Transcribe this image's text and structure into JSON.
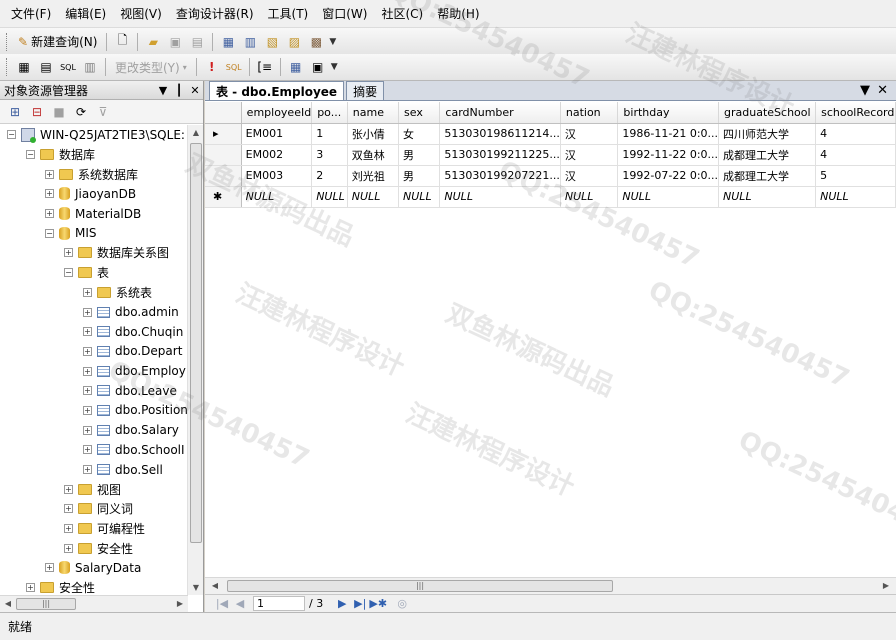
{
  "menubar": [
    "文件(F)",
    "编辑(E)",
    "视图(V)",
    "查询设计器(R)",
    "工具(T)",
    "窗口(W)",
    "社区(C)",
    "帮助(H)"
  ],
  "toolbar1": {
    "new_query": "新建查询(N)"
  },
  "toolbar2": {
    "change_type": "更改类型(Y)"
  },
  "object_explorer": {
    "title": "对象资源管理器",
    "tree": [
      {
        "depth": 0,
        "icon": "server-icon",
        "expander": "−",
        "label": "WIN-Q25JAT2TIE3\\SQLE:"
      },
      {
        "depth": 1,
        "icon": "folder-icon",
        "expander": "−",
        "label": "数据库"
      },
      {
        "depth": 2,
        "icon": "folder-icon",
        "expander": "+",
        "label": "系统数据库"
      },
      {
        "depth": 2,
        "icon": "database-icon",
        "expander": "+",
        "label": "JiaoyanDB"
      },
      {
        "depth": 2,
        "icon": "database-icon",
        "expander": "+",
        "label": "MaterialDB"
      },
      {
        "depth": 2,
        "icon": "database-icon",
        "expander": "−",
        "label": "MIS"
      },
      {
        "depth": 3,
        "icon": "folder-icon",
        "expander": "+",
        "label": "数据库关系图"
      },
      {
        "depth": 3,
        "icon": "folder-icon",
        "expander": "−",
        "label": "表"
      },
      {
        "depth": 4,
        "icon": "folder-icon",
        "expander": "+",
        "label": "系统表"
      },
      {
        "depth": 4,
        "icon": "table-icon",
        "expander": "+",
        "label": "dbo.admin"
      },
      {
        "depth": 4,
        "icon": "table-icon",
        "expander": "+",
        "label": "dbo.Chuqin"
      },
      {
        "depth": 4,
        "icon": "table-icon",
        "expander": "+",
        "label": "dbo.Depart"
      },
      {
        "depth": 4,
        "icon": "table-icon",
        "expander": "+",
        "label": "dbo.Employ"
      },
      {
        "depth": 4,
        "icon": "table-icon",
        "expander": "+",
        "label": "dbo.Leave"
      },
      {
        "depth": 4,
        "icon": "table-icon",
        "expander": "+",
        "label": "dbo.Position"
      },
      {
        "depth": 4,
        "icon": "table-icon",
        "expander": "+",
        "label": "dbo.Salary"
      },
      {
        "depth": 4,
        "icon": "table-icon",
        "expander": "+",
        "label": "dbo.SchoolI"
      },
      {
        "depth": 4,
        "icon": "table-icon",
        "expander": "+",
        "label": "dbo.Sell"
      },
      {
        "depth": 3,
        "icon": "folder-icon",
        "expander": "+",
        "label": "视图"
      },
      {
        "depth": 3,
        "icon": "folder-icon",
        "expander": "+",
        "label": "同义词"
      },
      {
        "depth": 3,
        "icon": "folder-icon",
        "expander": "+",
        "label": "可编程性"
      },
      {
        "depth": 3,
        "icon": "folder-icon",
        "expander": "+",
        "label": "安全性"
      },
      {
        "depth": 2,
        "icon": "database-icon",
        "expander": "+",
        "label": "SalaryData"
      },
      {
        "depth": 1,
        "icon": "folder-icon",
        "expander": "+",
        "label": "安全性"
      }
    ]
  },
  "tabs": [
    {
      "label": "表 - dbo.Employee",
      "active": true
    },
    {
      "label": "摘要",
      "active": false
    }
  ],
  "grid": {
    "columns": [
      "employeeId",
      "po...",
      "name",
      "sex",
      "cardNumber",
      "nation",
      "birthday",
      "graduateSchool",
      "schoolRecord"
    ],
    "rows": [
      {
        "marker": "▸",
        "cells": [
          "EM001",
          "1",
          "张小倩",
          "女",
          "513030198611214...",
          "汉",
          "1986-11-21 0:0...",
          "四川师范大学",
          "4"
        ]
      },
      {
        "marker": "",
        "cells": [
          "EM002",
          "3",
          "双鱼林",
          "男",
          "513030199211225...",
          "汉",
          "1992-11-22 0:0...",
          "成都理工大学",
          "4"
        ]
      },
      {
        "marker": "",
        "cells": [
          "EM003",
          "2",
          "刘光祖",
          "男",
          "513030199207221...",
          "汉",
          "1992-07-22 0:0...",
          "成都理工大学",
          "5"
        ]
      },
      {
        "marker": "✱",
        "cells": [
          "NULL",
          "NULL",
          "NULL",
          "NULL",
          "NULL",
          "NULL",
          "NULL",
          "NULL",
          "NULL"
        ]
      }
    ]
  },
  "navigator": {
    "current": "1",
    "total": "/ 3"
  },
  "status": "就绪",
  "watermarks": [
    "QQ:254540457",
    "汪建林程序设计",
    "双鱼林源码出品",
    "QQ:254540457",
    "汪建林程序设计",
    "双鱼林源码出品",
    "QQ:254540457",
    "QQ:254540457",
    "汪建林程序设计",
    "QQ:254540457"
  ]
}
